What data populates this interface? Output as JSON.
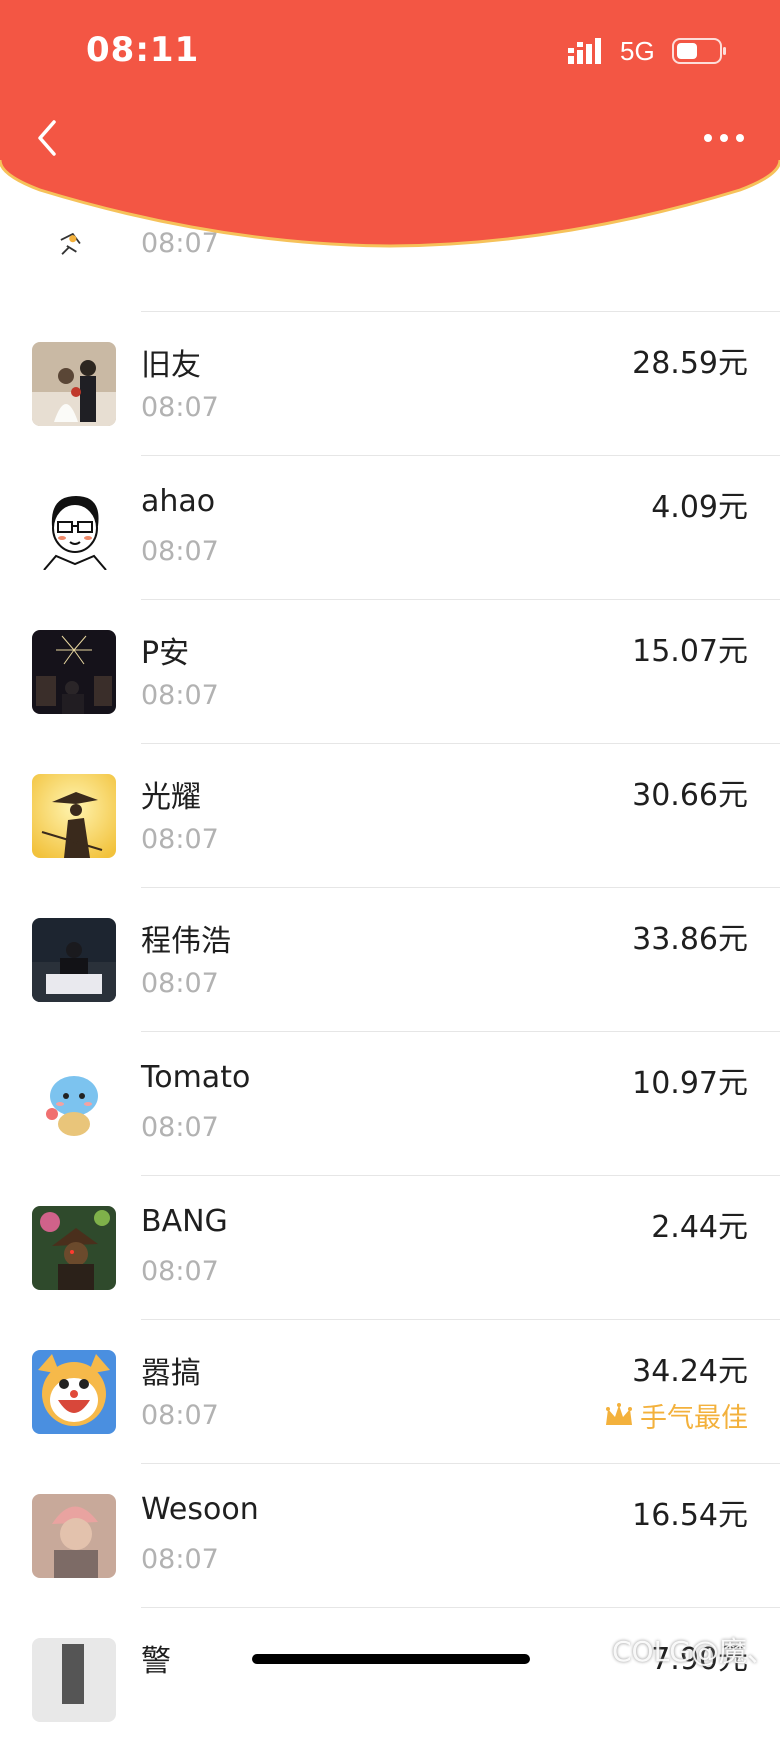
{
  "status_bar": {
    "time": "08:11",
    "network": "5G"
  },
  "colors": {
    "header_red": "#F35644",
    "header_edge": "#F6C25A",
    "best_gold": "#F3B13C"
  },
  "header": {
    "back_icon": "chevron-left-icon",
    "more_icon": "more-dots-icon"
  },
  "top_partial": {
    "time": "08:07"
  },
  "rows": [
    {
      "name": "旧友",
      "time": "08:07",
      "amount": "28.59元"
    },
    {
      "name": "ahao",
      "time": "08:07",
      "amount": "4.09元"
    },
    {
      "name": "P安",
      "time": "08:07",
      "amount": "15.07元"
    },
    {
      "name": "光耀",
      "time": "08:07",
      "amount": "30.66元"
    },
    {
      "name": "程伟浩",
      "time": "08:07",
      "amount": "33.86元"
    },
    {
      "name": "Tomato",
      "time": "08:07",
      "amount": "10.97元"
    },
    {
      "name": "BANG",
      "time": "08:07",
      "amount": "2.44元"
    },
    {
      "name": "嚣搞",
      "time": "08:07",
      "amount": "34.24元",
      "best_label": "手气最佳"
    },
    {
      "name": "Wesoon",
      "time": "08:07",
      "amount": "16.54元"
    },
    {
      "name": "警",
      "time": "",
      "amount": "7.90元"
    }
  ],
  "watermark": "COLG@魔、"
}
